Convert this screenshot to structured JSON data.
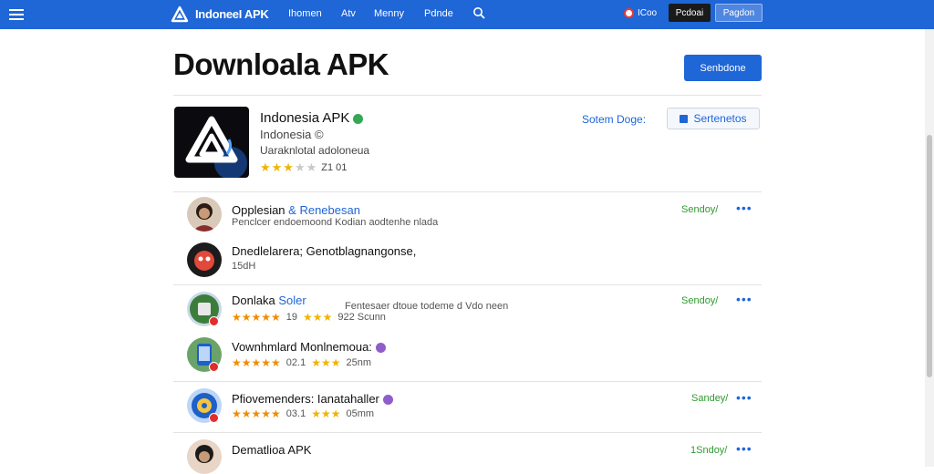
{
  "header": {
    "brand": "IndoneeI APK",
    "nav": [
      "Ihomen",
      "Atv",
      "Menny",
      "Pdnde"
    ],
    "region": "ICoo",
    "dark_button": "Pcdoai",
    "light_button": "Pagdon"
  },
  "main": {
    "title": "Downloala APK",
    "primary_button": "Senbdone"
  },
  "hero": {
    "name": "Indonesia APK",
    "developer": "Indonesia ©",
    "description": "Uaraknlotal adoloneua",
    "rating_count": "Z1 01",
    "side_label": "Sotem Doge:",
    "side_button": "Sertenetos"
  },
  "list": [
    {
      "title": "Opplesian",
      "tag": "& Renebesan",
      "sub": "Penclcer endoemoond Kodian  aodtenhe nlada",
      "date": "Sendoy/",
      "has_more": true
    },
    {
      "title": "Dnedlelarera; Genotblagnangonse,",
      "sub": "15dH"
    },
    {
      "title": "Donlaka",
      "tag": "Soler",
      "mid": "Fentesaer dtoue todeme d Vdo neen",
      "rating_left": "19",
      "rating_right": "922  Scunn",
      "date": "Sendoy/",
      "has_more": true
    },
    {
      "title": "Vownhmlard Monlnemoua:",
      "rating_left": "02.1",
      "rating_right": "25nm",
      "has_more": false
    },
    {
      "title": "Pfiovemenders: Ianatahaller",
      "rating_left": "03.1",
      "rating_right": "05mm",
      "date": "Sandey/",
      "has_more": true
    },
    {
      "title": "Dematlioa APK",
      "date": "1Sndoy/",
      "has_more": true
    }
  ],
  "colors": {
    "topbar": "#1f66d6",
    "accent": "#1f66d6",
    "date_green": "#2e9a2e",
    "star": "#f0b400"
  }
}
